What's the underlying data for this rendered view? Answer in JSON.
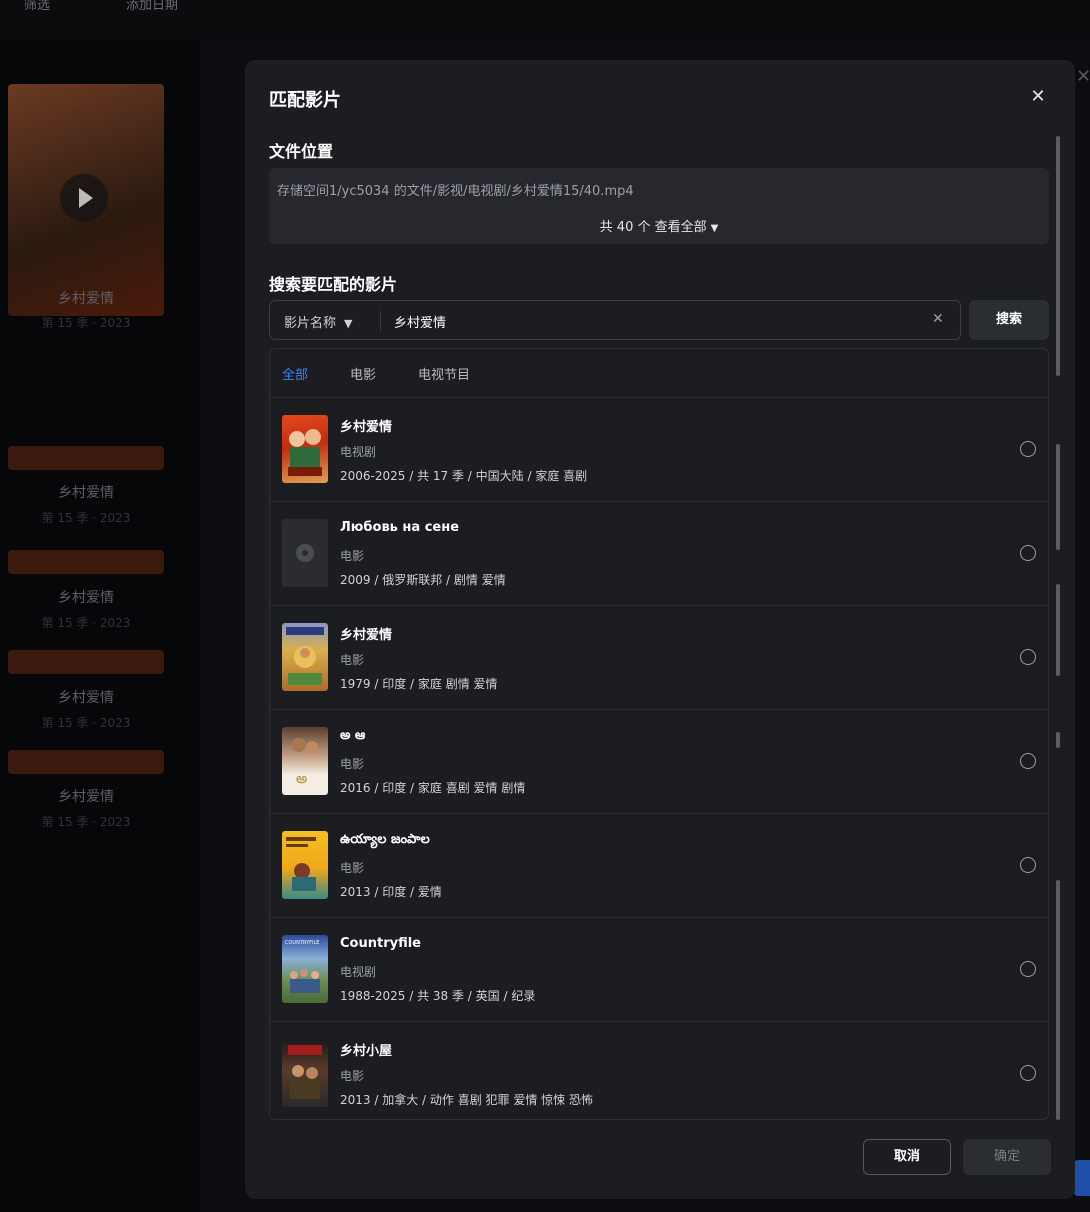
{
  "background": {
    "filters": [
      "筛选",
      "添加日期"
    ],
    "cards": [
      {
        "title": "乡村爱情",
        "subtitle": "第 15 季 · 2023"
      },
      {
        "title": "乡村爱情",
        "subtitle": "第 15 季 · 2023"
      },
      {
        "title": "乡村爱情",
        "subtitle": "第 15 季 · 2023"
      },
      {
        "title": "乡村爱情",
        "subtitle": "第 15 季 · 2023"
      },
      {
        "title": "乡村爱情",
        "subtitle": "第 15 季 · 2023"
      }
    ]
  },
  "modal": {
    "title": "匹配影片",
    "file_section_title": "文件位置",
    "file_path": "存储空间1/yc5034 的文件/影视/电视剧/乡村爱情15/40.mp4",
    "view_all": "共 40 个 查看全部",
    "search_section_title": "搜索要匹配的影片",
    "search": {
      "type_label": "影片名称",
      "value": "乡村爱情",
      "button_label": "搜索"
    },
    "tabs": [
      "全部",
      "电影",
      "电视节目"
    ],
    "results": [
      {
        "title": "乡村爱情",
        "type": "电视剧",
        "meta": "2006-2025 / 共 17 季 / 中国大陆 / 家庭 喜剧"
      },
      {
        "title": "Любовь на сене",
        "type": "电影",
        "meta": "2009 / 俄罗斯联邦 / 剧情 爱情"
      },
      {
        "title": "乡村爱情",
        "type": "电影",
        "meta": "1979 / 印度 / 家庭 剧情 爱情"
      },
      {
        "title": "అ ఆ",
        "type": "电影",
        "meta": "2016 / 印度 / 家庭 喜剧 爱情 剧情"
      },
      {
        "title": "ఉయ్యాల జంపాల",
        "type": "电影",
        "meta": "2013 / 印度 / 爱情"
      },
      {
        "title": "Countryfile",
        "type": "电视剧",
        "meta": "1988-2025 / 共 38 季 / 英国 / 纪录"
      },
      {
        "title": "乡村小屋",
        "type": "电影",
        "meta": "2013 / 加拿大 / 动作 喜剧 犯罪 爱情 惊悚 恐怖"
      }
    ],
    "cancel_label": "取消",
    "confirm_label": "确定"
  }
}
